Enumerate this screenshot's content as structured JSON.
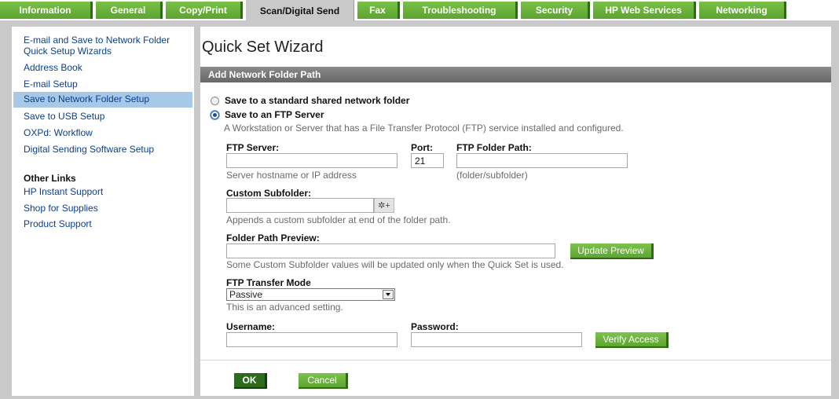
{
  "tabs": [
    {
      "label": "Information"
    },
    {
      "label": "General"
    },
    {
      "label": "Copy/Print"
    },
    {
      "label": "Scan/Digital Send"
    },
    {
      "label": "Fax"
    },
    {
      "label": "Troubleshooting"
    },
    {
      "label": "Security"
    },
    {
      "label": "HP Web Services"
    },
    {
      "label": "Networking"
    }
  ],
  "sidebar": {
    "items": [
      {
        "label": "E-mail and Save to Network Folder Quick Setup Wizards"
      },
      {
        "label": "Address Book"
      },
      {
        "label": "E-mail Setup"
      },
      {
        "label": "Save to Network Folder Setup"
      },
      {
        "label": "Save to USB Setup"
      },
      {
        "label": "OXPd: Workflow"
      },
      {
        "label": "Digital Sending Software Setup"
      }
    ],
    "other_links_heading": "Other Links",
    "other_links": [
      {
        "label": "HP Instant Support"
      },
      {
        "label": "Shop for Supplies"
      },
      {
        "label": "Product Support"
      }
    ]
  },
  "main": {
    "title": "Quick Set Wizard",
    "section_header": "Add Network Folder Path",
    "radio_standard": "Save to a standard shared network folder",
    "radio_ftp": "Save to an FTP Server",
    "ftp_description": "A Workstation or Server that has a File Transfer Protocol (FTP) service installed and configured.",
    "ftp_server_label": "FTP Server:",
    "ftp_server_value": "",
    "ftp_server_hint": "Server hostname or IP address",
    "port_label": "Port:",
    "port_value": "21",
    "folder_path_label": "FTP Folder Path:",
    "folder_path_value": "",
    "folder_path_hint": "(folder/subfolder)",
    "custom_subfolder_label": "Custom Subfolder:",
    "custom_subfolder_value": "",
    "custom_subfolder_icon_text": "✲+",
    "custom_subfolder_hint": "Appends a custom subfolder at end of the folder path.",
    "preview_label": "Folder Path Preview:",
    "preview_value": "",
    "update_preview_button": "Update Preview",
    "preview_hint": "Some Custom Subfolder values will be updated only when the Quick Set is used.",
    "transfer_mode_label": "FTP Transfer Mode",
    "transfer_mode_value": "Passive",
    "transfer_mode_hint": "This is an advanced setting.",
    "username_label": "Username:",
    "username_value": "",
    "password_label": "Password:",
    "password_value": "",
    "verify_access_button": "Verify Access",
    "ok_button": "OK",
    "cancel_button": "Cancel"
  },
  "colors": {
    "tab_green": "#6ab23d",
    "sidebar_selected": "#a7c8e6",
    "link_blue": "#0b3f8f",
    "section_header_gray": "#777777"
  }
}
